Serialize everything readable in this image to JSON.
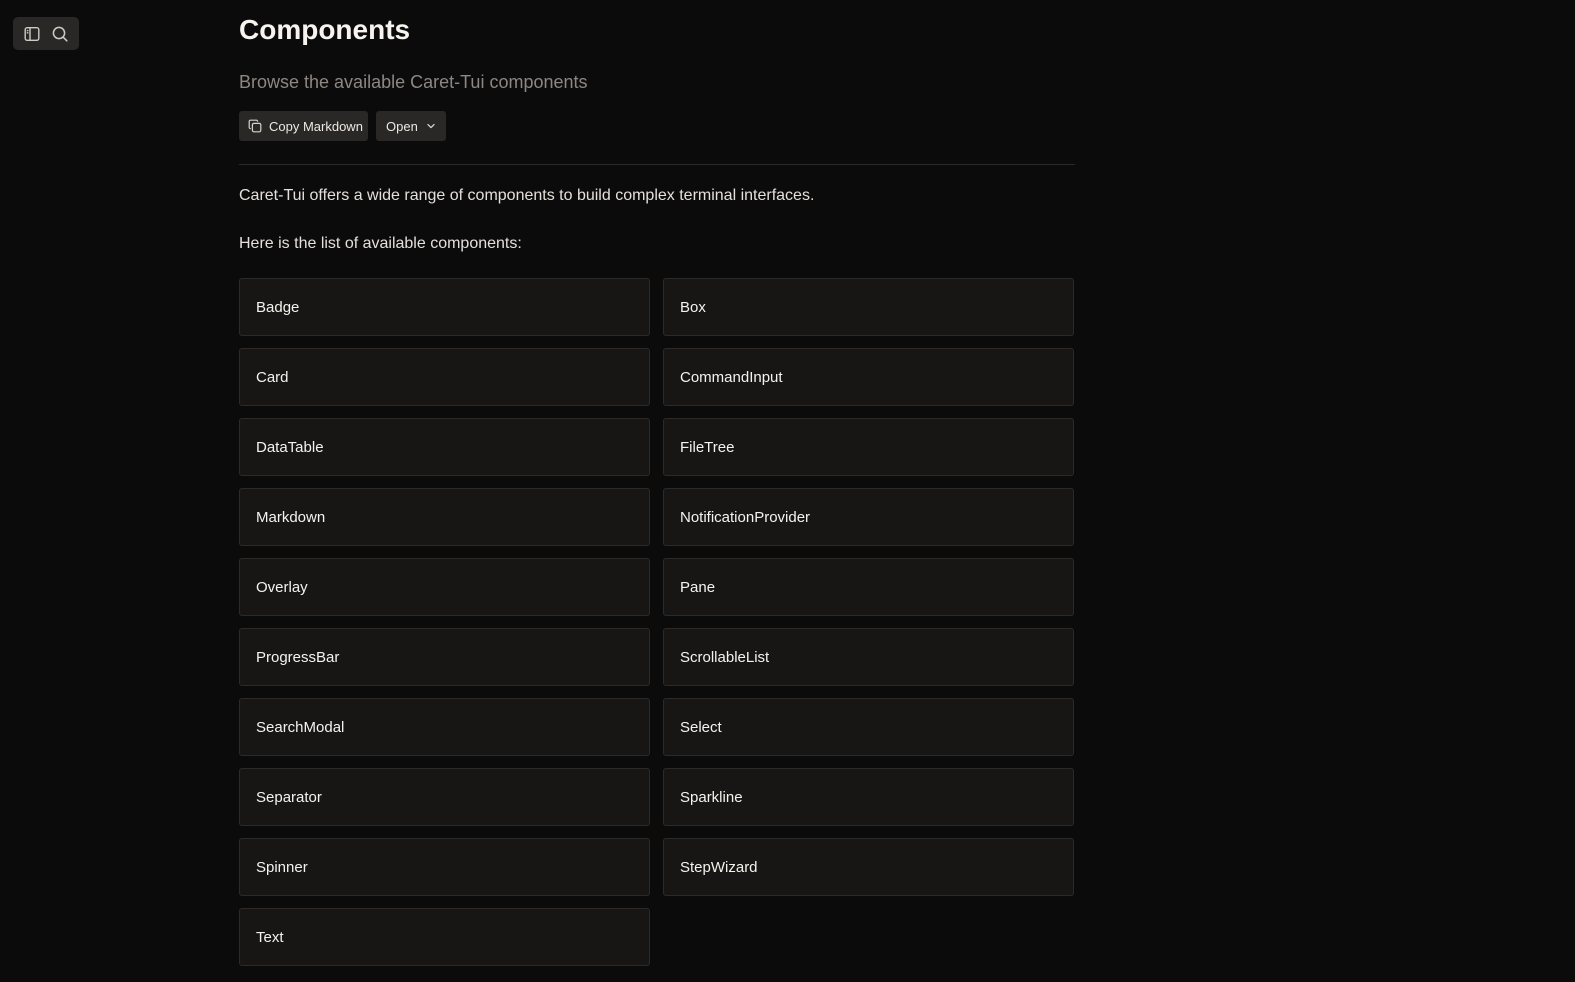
{
  "toolbar": {
    "sidebar_toggle_icon": "sidebar-panel-icon",
    "search_icon": "search-icon"
  },
  "header": {
    "title": "Components",
    "subtitle": "Browse the available Caret-Tui components"
  },
  "actions": {
    "copy_label": "Copy Markdown",
    "copy_icon": "copy-icon",
    "open_label": "Open",
    "open_icon": "chevron-down-icon"
  },
  "content": {
    "intro": "Caret-Tui offers a wide range of components to build complex terminal interfaces.",
    "list_intro": "Here is the list of available components:"
  },
  "components": [
    "Badge",
    "Box",
    "Card",
    "CommandInput",
    "DataTable",
    "FileTree",
    "Markdown",
    "NotificationProvider",
    "Overlay",
    "Pane",
    "ProgressBar",
    "ScrollableList",
    "SearchModal",
    "Select",
    "Separator",
    "Sparkline",
    "Spinner",
    "StepWizard",
    "Text"
  ],
  "colors": {
    "background": "#0c0b0b",
    "card_background": "#181614",
    "card_border": "#2c2927",
    "button_background": "#2a2826",
    "subtitle_text": "#8c8782"
  }
}
